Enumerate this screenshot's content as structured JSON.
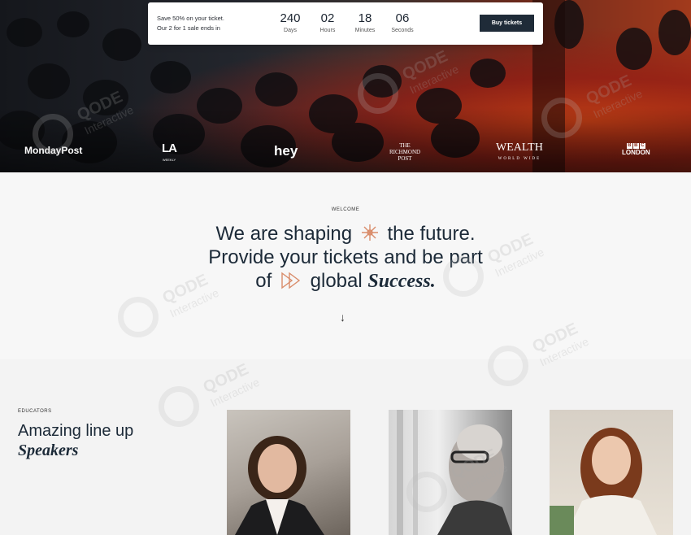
{
  "countdown": {
    "promo_line1": "Save 50% on your ticket.",
    "promo_line2": "Our 2 for 1 sale ends in",
    "units": [
      {
        "value": "240",
        "label": "Days"
      },
      {
        "value": "02",
        "label": "Hours"
      },
      {
        "value": "18",
        "label": "Minutes"
      },
      {
        "value": "06",
        "label": "Seconds"
      }
    ],
    "buy_label": "Buy tickets"
  },
  "logos": {
    "monday": "MondayPost",
    "la": "LA",
    "la_sub": "WEEKLY",
    "hey": "hey",
    "richmond": "THE RICHMOND POST",
    "wealth": "WEALTH",
    "wealth_sub": "WORLD WIDE",
    "bbc_letters": [
      "B",
      "B",
      "C"
    ],
    "bbc_city": "LONDON"
  },
  "welcome": {
    "eyebrow": "WELCOME",
    "line1_a": "We are shaping",
    "line1_b": "the future.",
    "line2": "Provide your tickets and be part",
    "line3_a": "of",
    "line3_b": "global",
    "line3_c": "Success.",
    "arrow": "↓"
  },
  "speakers": {
    "eyebrow": "EDUCATORS",
    "title": "Amazing line up",
    "title_italic": "Speakers"
  },
  "watermark": {
    "brand": "QODE",
    "sub": "Interactive"
  },
  "colors": {
    "accent": "#d98c6a",
    "dark": "#1f2b38"
  }
}
